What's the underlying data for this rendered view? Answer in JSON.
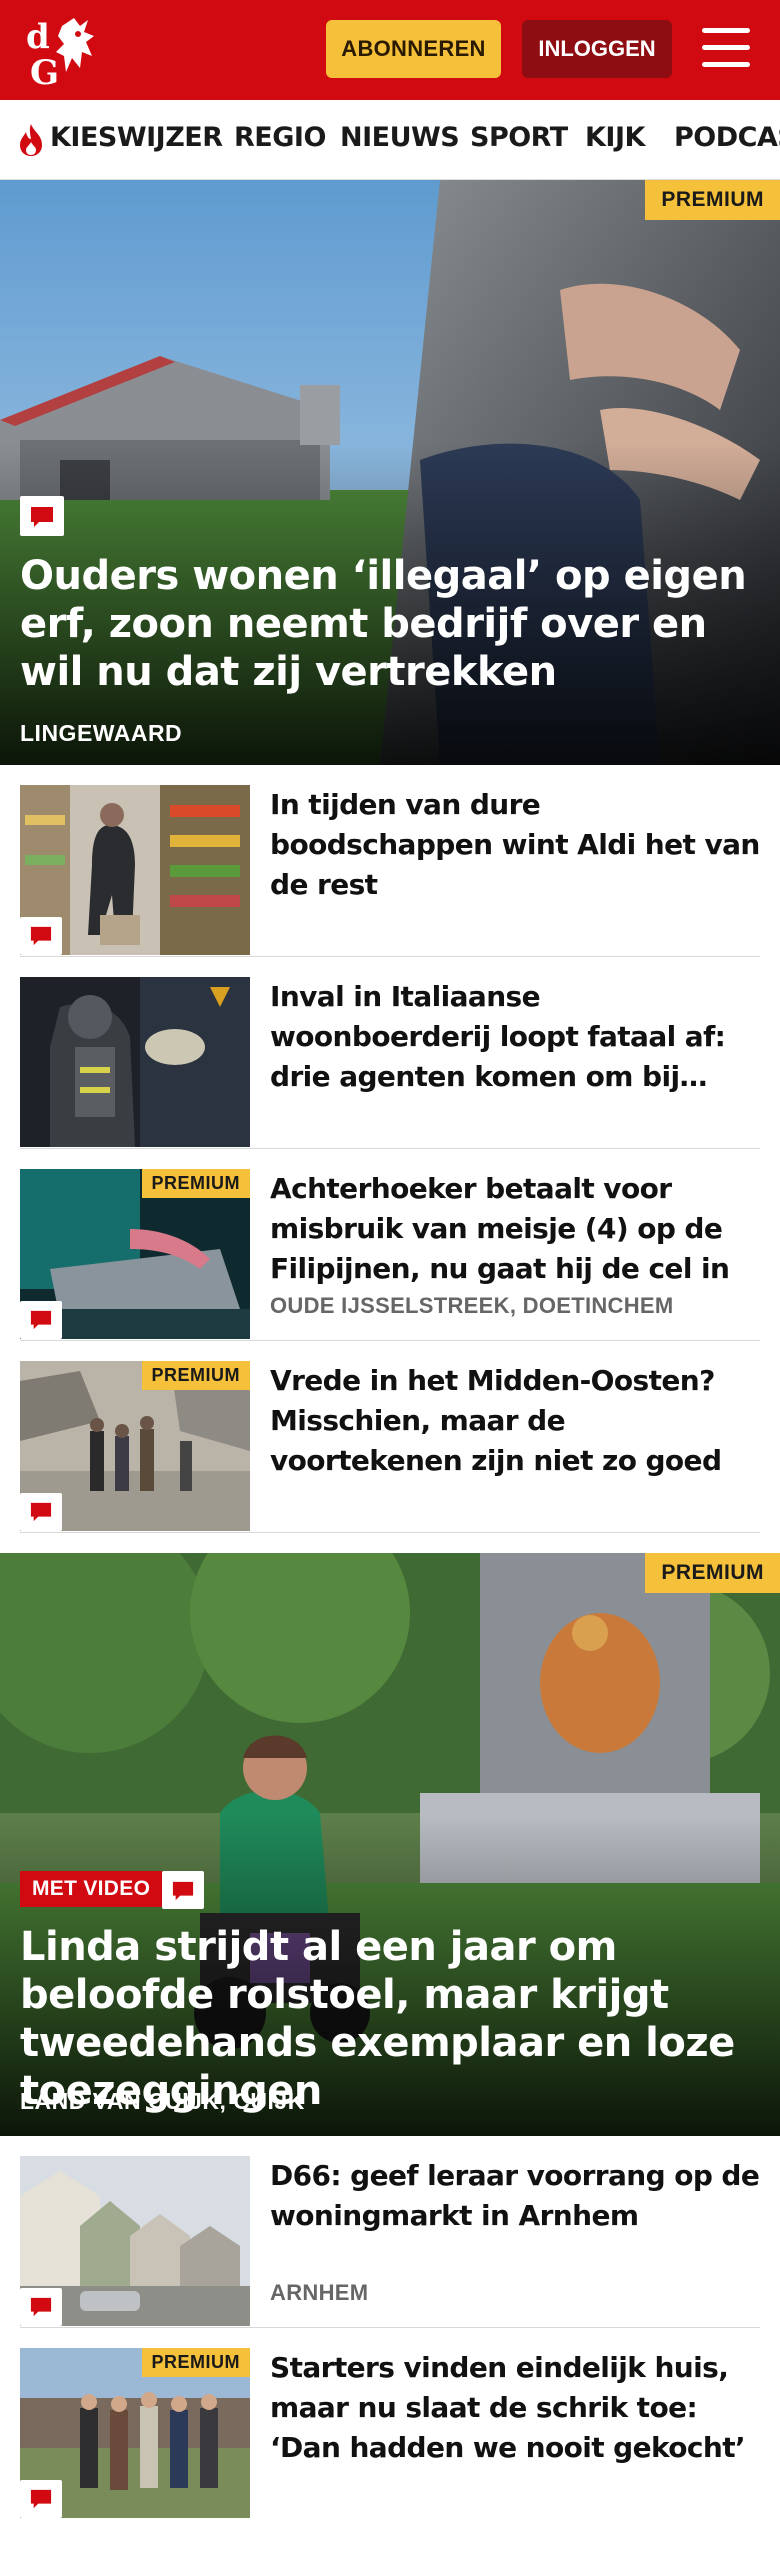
{
  "header": {
    "logo_alt": "dG",
    "subscribe_label": "ABONNEREN",
    "login_label": "INLOGGEN",
    "menu_icon": "hamburger-icon",
    "brand_color": "#d10a11",
    "accent_color": "#f5c03a"
  },
  "nav": {
    "items": [
      {
        "label": "KIESWIJZER",
        "icon": "flame-icon"
      },
      {
        "label": "REGIO"
      },
      {
        "label": "NIEUWS"
      },
      {
        "label": "SPORT"
      },
      {
        "label": "KIJK"
      },
      {
        "label": "PODCAS"
      }
    ]
  },
  "hero1": {
    "badge": "PREMIUM",
    "title": "Ouders wonen ‘illegaal’ op eigen erf, zoon neemt bedrijf over en wil nu dat zij vertrekken",
    "location": "LINGEWAARD",
    "comment_icon": "comment-icon"
  },
  "articles": [
    {
      "title": "In tijden van dure boodschappen wint Aldi het van de rest",
      "premium": "",
      "location": ""
    },
    {
      "title": "Inval in Italiaanse woonboerderij loopt fataal af: drie agenten komen om bij explosie, dertien gewonden",
      "premium": "",
      "location": ""
    },
    {
      "title": "Achterhoeker betaalt voor misbruik van meisje (4) op de Filipijnen, nu gaat hij de cel in",
      "premium": "PREMIUM",
      "location": "OUDE IJSSELSTREEK, DOETINCHEM"
    },
    {
      "title": "Vrede in het Midden-Oosten? Misschien, maar de voortekenen zijn niet zo goed",
      "premium": "PREMIUM",
      "location": ""
    }
  ],
  "hero2": {
    "badge": "PREMIUM",
    "video_label": "MET VIDEO",
    "title": "Linda strijdt al een jaar om beloofde rolstoel, maar krijgt tweedehands exemplaar en loze toezeggingen",
    "location": "LAND VAN CUIJK, CUIJK"
  },
  "articles2": [
    {
      "title": "D66: geef leraar voorrang op de woningmarkt in Arnhem",
      "premium": "",
      "location": "ARNHEM"
    },
    {
      "title": "Starters vinden eindelijk huis, maar nu slaat de schrik toe: ‘Dan hadden we nooit gekocht’",
      "premium": "PREMIUM",
      "location": ""
    }
  ]
}
